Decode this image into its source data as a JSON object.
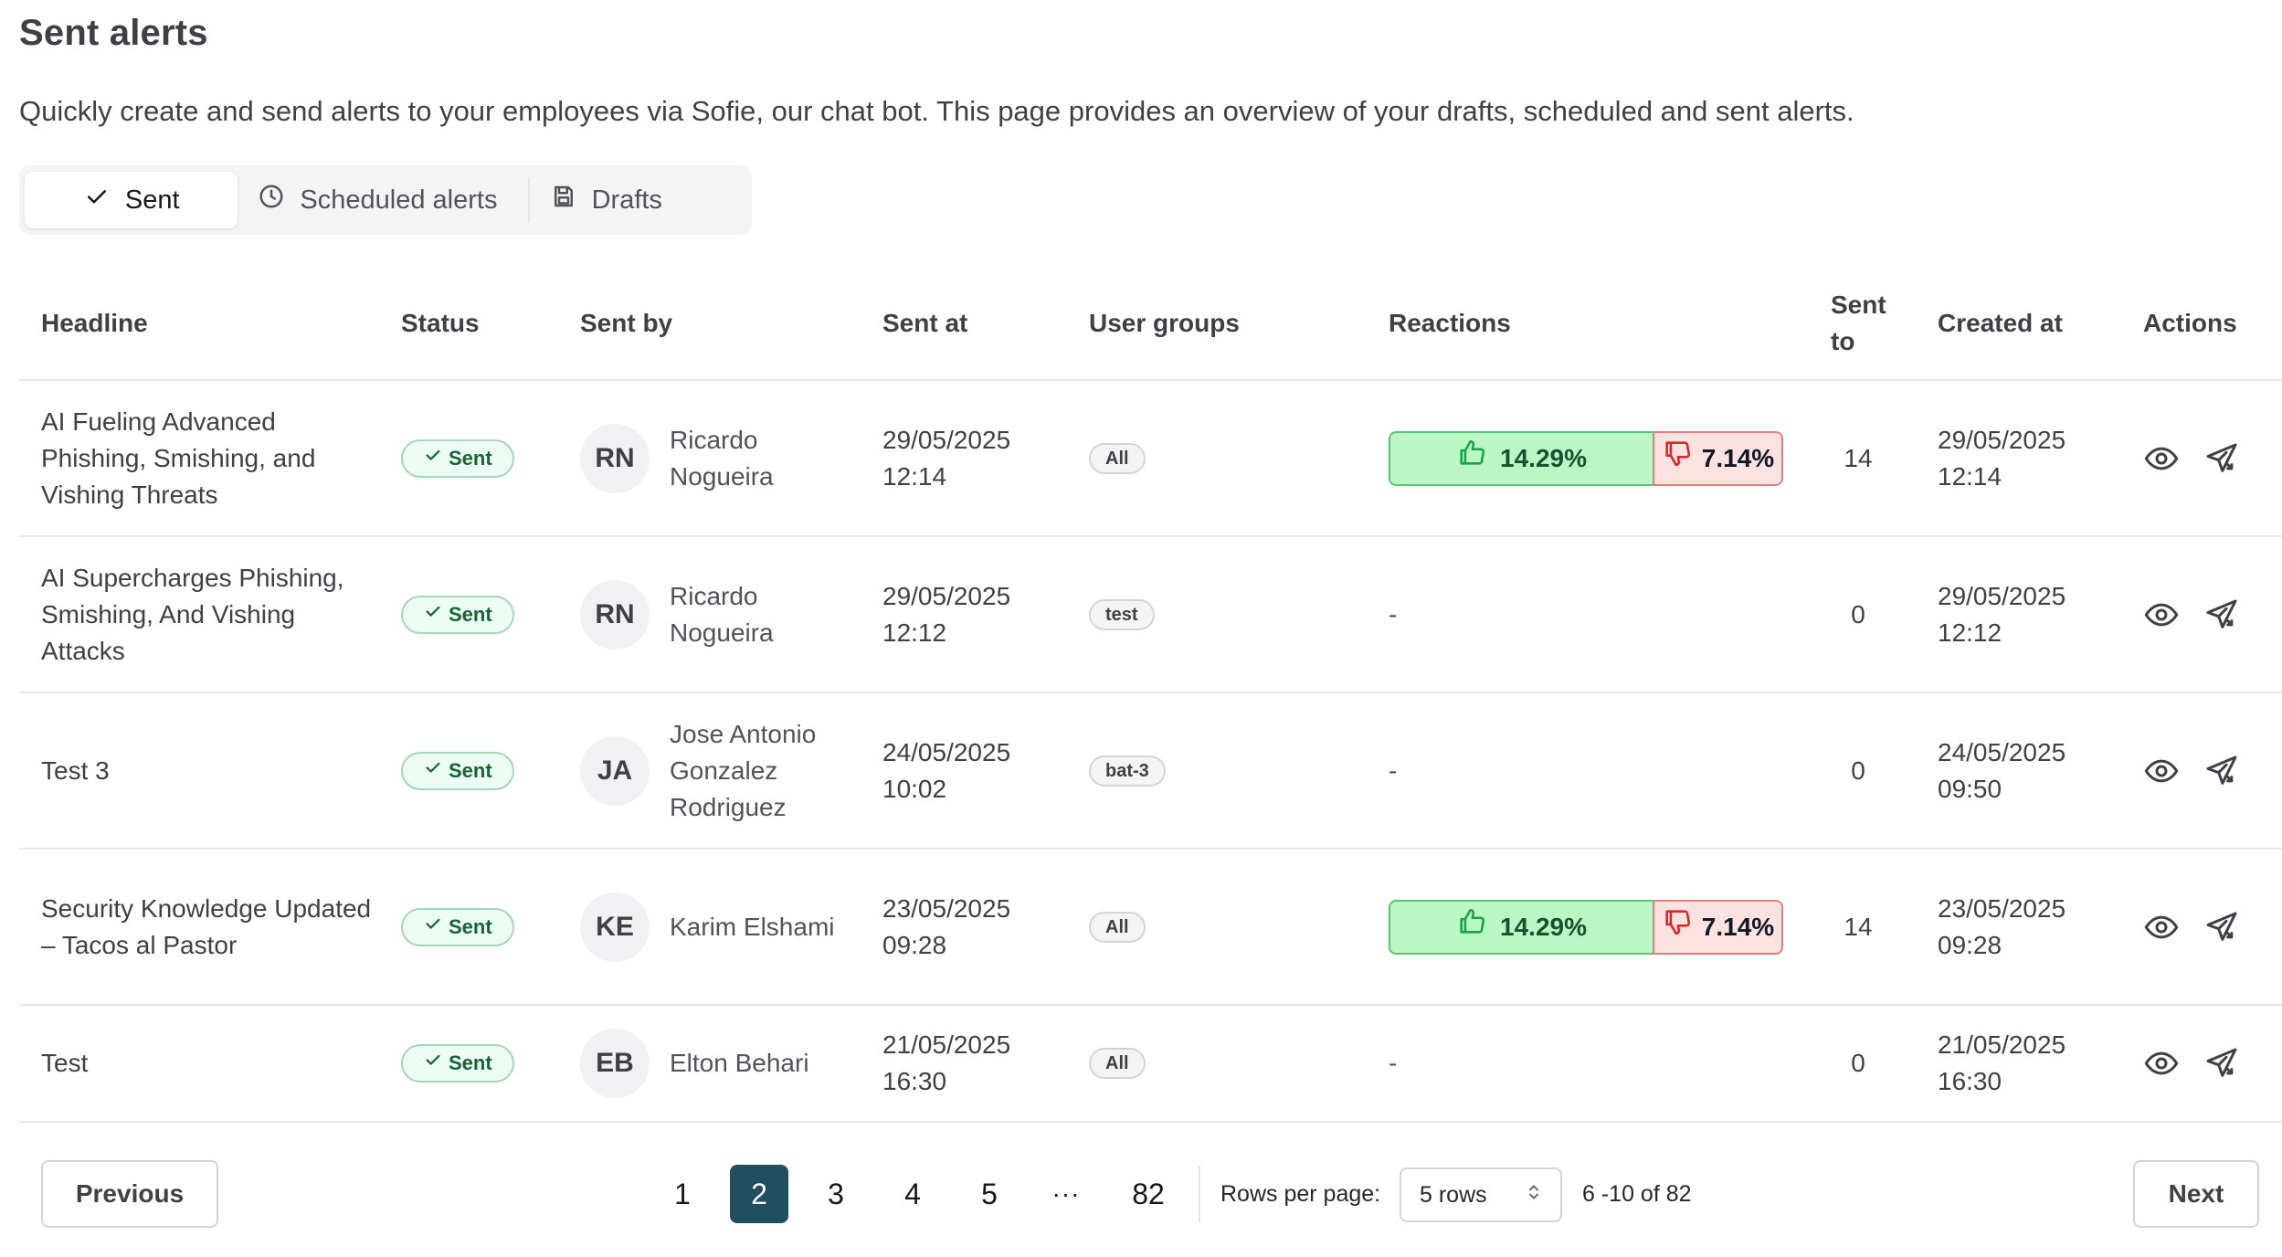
{
  "page": {
    "title": "Sent alerts",
    "description": "Quickly create and send alerts to your employees via Sofie, our chat bot. This page provides an overview of your drafts, scheduled and sent alerts."
  },
  "tabs": [
    {
      "label": "Sent",
      "icon": "check-icon",
      "active": true
    },
    {
      "label": "Scheduled alerts",
      "icon": "clock-icon",
      "active": false
    },
    {
      "label": "Drafts",
      "icon": "floppy-disk-icon",
      "active": false
    }
  ],
  "table": {
    "headers": {
      "headline": "Headline",
      "status": "Status",
      "sent_by": "Sent by",
      "sent_at": "Sent at",
      "user_groups": "User groups",
      "reactions": "Reactions",
      "sent_to_1": "Sent",
      "sent_to_2": "to",
      "created_at": "Created at",
      "actions": "Actions"
    },
    "rows": [
      {
        "headline": "AI Fueling Advanced Phishing, Smishing, and Vishing Threats",
        "status": "Sent",
        "initials": "RN",
        "sender": "Ricardo Nogueira",
        "sent_at_date": "29/05/2025",
        "sent_at_time": "12:14",
        "group": "All",
        "reaction_up": "14.29%",
        "reaction_down": "7.14%",
        "reaction_up_share": 0.67,
        "sent_to": "14",
        "created_date": "29/05/2025",
        "created_time": "12:14"
      },
      {
        "headline": "AI Supercharges Phishing, Smishing, And Vishing Attacks",
        "status": "Sent",
        "initials": "RN",
        "sender": "Ricardo Nogueira",
        "sent_at_date": "29/05/2025",
        "sent_at_time": "12:12",
        "group": "test",
        "reaction_none": "-",
        "sent_to": "0",
        "created_date": "29/05/2025",
        "created_time": "12:12"
      },
      {
        "headline": "Test 3",
        "status": "Sent",
        "initials": "JA",
        "sender": "Jose Antonio Gonzalez Rodriguez",
        "sent_at_date": "24/05/2025",
        "sent_at_time": "10:02",
        "group": "bat-3",
        "reaction_none": "-",
        "sent_to": "0",
        "created_date": "24/05/2025",
        "created_time": "09:50"
      },
      {
        "headline": "Security Knowledge Updated – Tacos al Pastor",
        "status": "Sent",
        "initials": "KE",
        "sender": "Karim Elshami",
        "sent_at_date": "23/05/2025",
        "sent_at_time": "09:28",
        "group": "All",
        "reaction_up": "14.29%",
        "reaction_down": "7.14%",
        "reaction_up_share": 0.67,
        "sent_to": "14",
        "created_date": "23/05/2025",
        "created_time": "09:28"
      },
      {
        "headline": "Test",
        "status": "Sent",
        "initials": "EB",
        "sender": "Elton Behari",
        "sent_at_date": "21/05/2025",
        "sent_at_time": "16:30",
        "group": "All",
        "reaction_none": "-",
        "sent_to": "0",
        "created_date": "21/05/2025",
        "created_time": "16:30"
      }
    ]
  },
  "pagination": {
    "previous_label": "Previous",
    "next_label": "Next",
    "pages": [
      "1",
      "2",
      "3",
      "4",
      "5"
    ],
    "ellipsis": "···",
    "last_page": "82",
    "current_page": "2",
    "rows_per_page_label": "Rows per page:",
    "rows_per_page_value": "5 rows",
    "range_text": "6 -10 of 82"
  },
  "colors": {
    "active_page": "#1f4f5e",
    "sent_badge_bg": "#ecfdf3",
    "reaction_up_bg": "#bbf7c5",
    "reaction_down_bg": "#fde2e2"
  }
}
